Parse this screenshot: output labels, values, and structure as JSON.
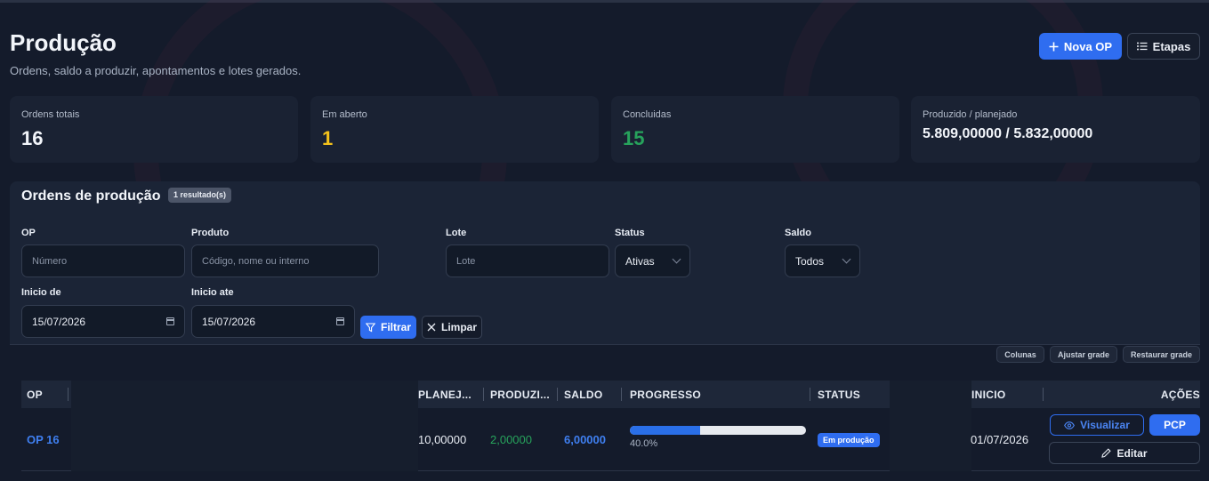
{
  "header": {
    "title": "Produção",
    "subtitle": "Ordens, saldo a produzir, apontamentos e lotes gerados.",
    "new_button": "Nova OP",
    "steps_button": "Etapas"
  },
  "summary": [
    {
      "label": "Ordens totais",
      "value": "16",
      "color": "#f2f5fa"
    },
    {
      "label": "Em aberto",
      "value": "1",
      "color": "#f4c21b"
    },
    {
      "label": "Concluidas",
      "value": "15",
      "color": "#27a35c"
    },
    {
      "label": "Produzido / planejado",
      "value": "5.809,00000 / 5.832,00000",
      "color": "#f2f5fa"
    }
  ],
  "panel": {
    "title": "Ordens de produção",
    "result_badge": "1 resultado(s)"
  },
  "filters": {
    "op": {
      "label": "OP",
      "placeholder": "Número"
    },
    "produto": {
      "label": "Produto",
      "placeholder": "Código, nome ou interno"
    },
    "lote": {
      "label": "Lote",
      "placeholder": "Lote"
    },
    "status": {
      "label": "Status",
      "value": "Ativas"
    },
    "saldo": {
      "label": "Saldo",
      "value": "Todos"
    },
    "inicio_de": {
      "label": "Inicio de",
      "value": "15/07/2026"
    },
    "inicio_ate": {
      "label": "Inicio ate",
      "value": "15/07/2026"
    },
    "filter_button": "Filtrar",
    "clear_button": "Limpar"
  },
  "grid_tools": {
    "columns": "Colunas",
    "adjust": "Ajustar grade",
    "restore": "Restaurar grade"
  },
  "table": {
    "headers": {
      "op": "OP",
      "planejado": "PLANEJ...",
      "produzido": "PRODUZI...",
      "saldo": "SALDO",
      "progresso": "PROGRESSO",
      "status": "STATUS",
      "inicio": "INICIO",
      "acoes": "AÇÕES"
    },
    "rows": [
      {
        "op": "OP 16",
        "planejado": "10,00000",
        "produzido": "2,00000",
        "saldo": "6,00000",
        "progress_text": "40.0%",
        "progress_fraction": 0.4,
        "status": "Em produção",
        "inicio": "01/07/2026",
        "actions": {
          "view": "Visualizar",
          "pcp": "PCP",
          "edit": "Editar"
        }
      }
    ]
  },
  "colors": {
    "accent": "#2f6df0",
    "open": "#f4c21b",
    "done": "#27a35c"
  }
}
